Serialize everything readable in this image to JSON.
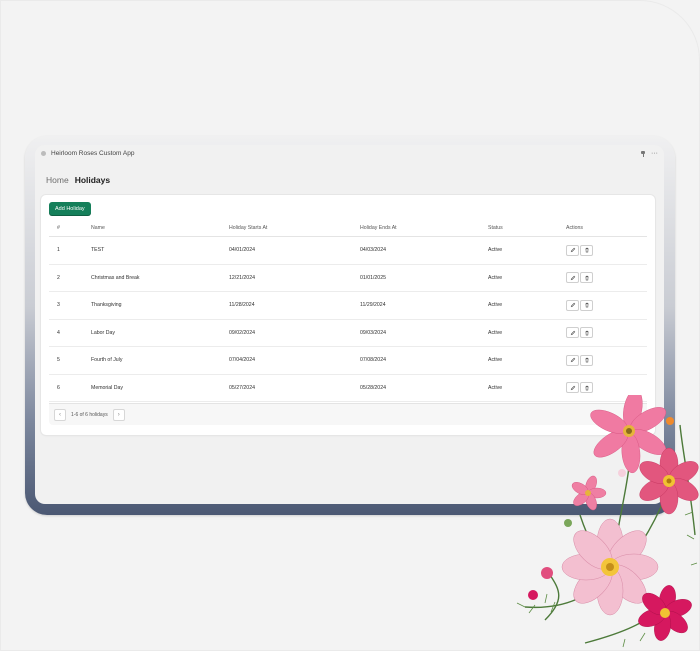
{
  "window": {
    "title": "Heirloom Roses Custom App"
  },
  "breadcrumb": {
    "home": "Home",
    "current": "Holidays"
  },
  "toolbar": {
    "add_label": "Add Holiday"
  },
  "table": {
    "headers": {
      "idx": "#",
      "name": "Name",
      "start": "Holiday Starts At",
      "end": "Holiday Ends At",
      "status": "Status",
      "actions": "Actions"
    },
    "rows": [
      {
        "idx": "1",
        "name": "TEST",
        "start": "04/01/2024",
        "end": "04/03/2024",
        "status": "Active"
      },
      {
        "idx": "2",
        "name": "Christmas and Break",
        "start": "12/21/2024",
        "end": "01/01/2025",
        "status": "Active"
      },
      {
        "idx": "3",
        "name": "Thanksgiving",
        "start": "11/28/2024",
        "end": "11/29/2024",
        "status": "Active"
      },
      {
        "idx": "4",
        "name": "Labor Day",
        "start": "09/02/2024",
        "end": "09/03/2024",
        "status": "Active"
      },
      {
        "idx": "5",
        "name": "Fourth of July",
        "start": "07/04/2024",
        "end": "07/08/2024",
        "status": "Active"
      },
      {
        "idx": "6",
        "name": "Memorial Day",
        "start": "05/27/2024",
        "end": "05/28/2024",
        "status": "Active"
      }
    ]
  },
  "pagination": {
    "summary": "1-6 of 6 holidays",
    "prev_icon": "chevron-left-icon",
    "next_icon": "chevron-right-icon"
  },
  "colors": {
    "primary": "#157f5a",
    "flower_pink": "#e2567e",
    "flower_magenta": "#d6185f"
  }
}
